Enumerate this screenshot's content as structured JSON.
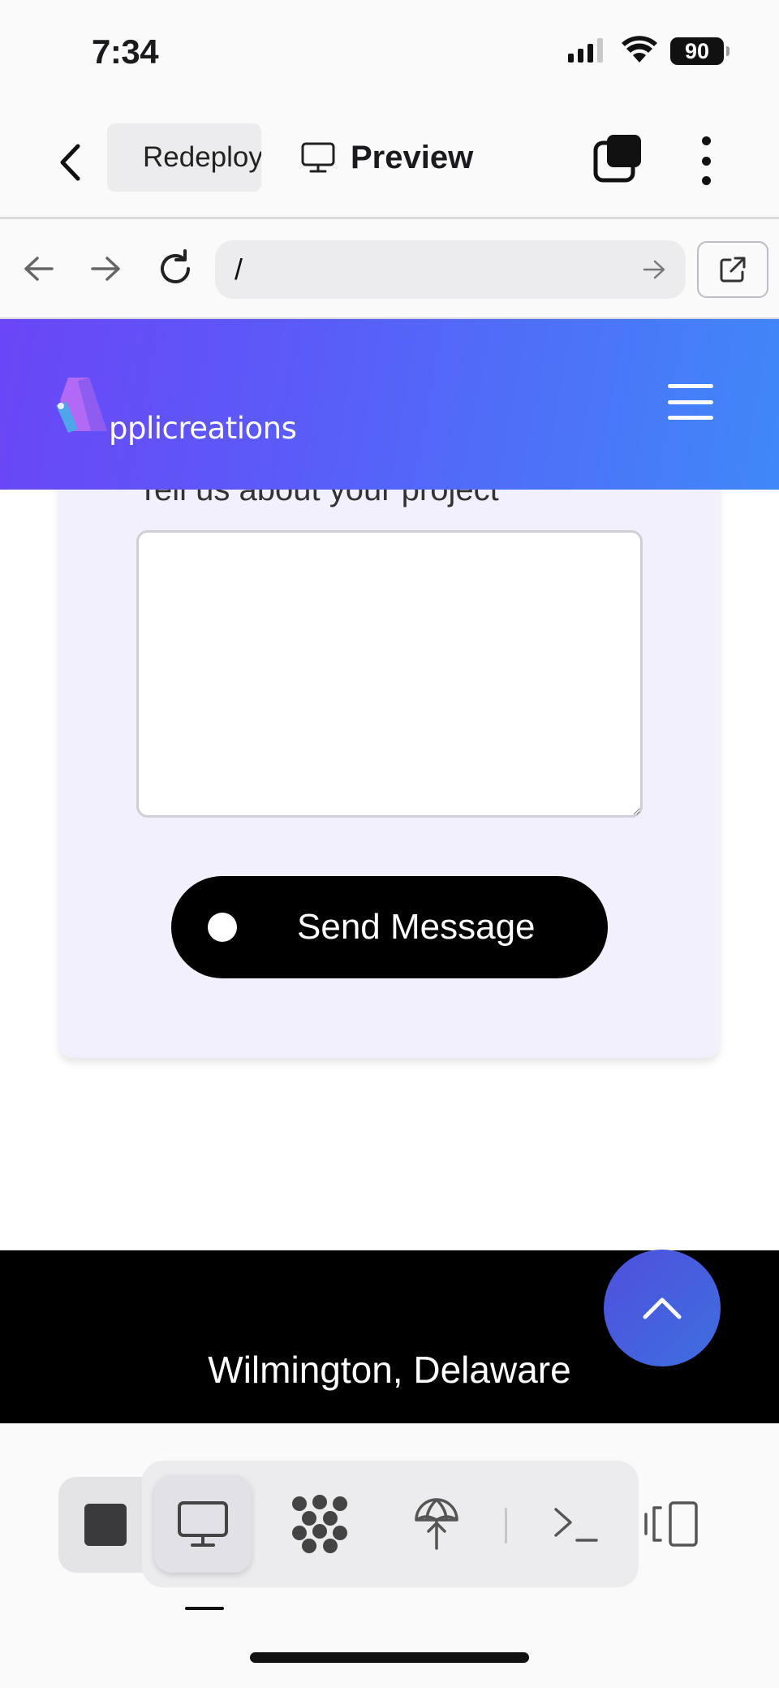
{
  "status_bar": {
    "time": "7:34",
    "battery": "90",
    "icons": [
      "cellular-signal-icon",
      "wifi-icon",
      "battery-icon"
    ]
  },
  "app_header": {
    "repl_name": "Redeployed",
    "preview_label": "Preview",
    "icons": [
      "back-chevron-icon",
      "replit-tree-icon",
      "monitor-icon",
      "tabs-icon",
      "more-vertical-icon"
    ]
  },
  "browser": {
    "url": "/",
    "icons": [
      "back-arrow-icon",
      "forward-arrow-icon",
      "reload-icon",
      "go-arrow-icon",
      "external-link-icon"
    ]
  },
  "site": {
    "brand": "pplicreations",
    "form": {
      "project_label": "Tell us about your project",
      "project_value": "",
      "send_label": "Send Message"
    },
    "footer": {
      "location": "Wilmington, Delaware"
    },
    "colors": {
      "header_gradient_start": "#6a46f6",
      "header_gradient_end": "#3f88f8",
      "card_bg": "#f3f0fd",
      "button_bg": "#000000",
      "back_to_top": "#4f5ddc"
    }
  },
  "toolbar": {
    "tools": [
      "stop-icon",
      "webview-monitor-icon",
      "workflows-icon",
      "deploy-icon",
      "shell-icon",
      "split-pane-icon"
    ],
    "active_tool": "webview-monitor-icon"
  }
}
